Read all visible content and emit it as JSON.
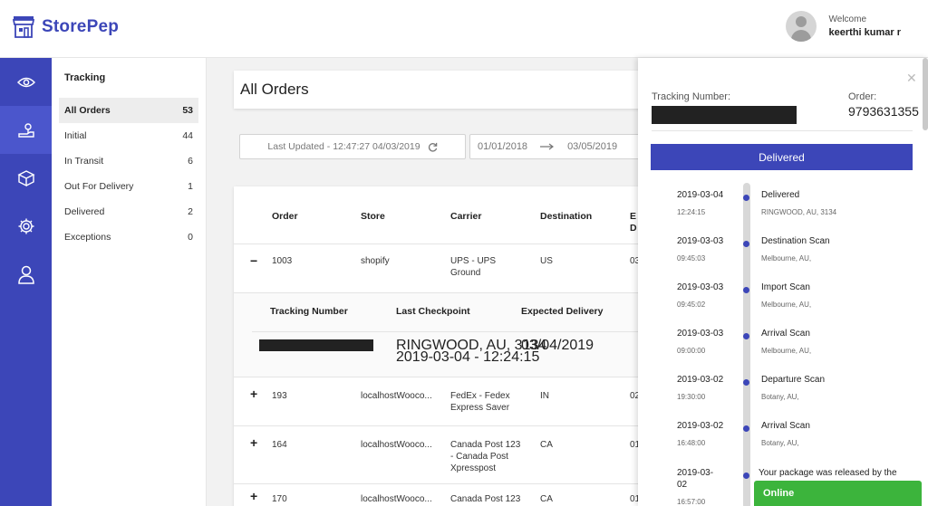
{
  "app": {
    "name": "StorePep"
  },
  "user": {
    "welcome": "Welcome",
    "name": "keerthi kumar r"
  },
  "rail": [
    {
      "icon": "eye-icon"
    },
    {
      "icon": "tracking-icon"
    },
    {
      "icon": "box-icon"
    },
    {
      "icon": "settings-icon"
    },
    {
      "icon": "user-icon"
    }
  ],
  "submenu": {
    "title": "Tracking",
    "items": [
      {
        "label": "All Orders",
        "count": "53"
      },
      {
        "label": "Initial",
        "count": "44"
      },
      {
        "label": "In Transit",
        "count": "6"
      },
      {
        "label": "Out For Delivery",
        "count": "1"
      },
      {
        "label": "Delivered",
        "count": "2"
      },
      {
        "label": "Exceptions",
        "count": "0"
      }
    ]
  },
  "main": {
    "title": "All Orders",
    "last_updated": "Last Updated - 12:47:27 04/03/2019",
    "date_from": "01/01/2018",
    "date_to": "03/05/2019"
  },
  "table": {
    "headers": {
      "order": "Order",
      "store": "Store",
      "carrier": "Carrier",
      "destination": "Destination",
      "expected": "E",
      "expected2": "D"
    },
    "rows": [
      {
        "toggle": "−",
        "order": "1003",
        "store": "shopify",
        "carrier": [
          "UPS - UPS",
          "Ground"
        ],
        "destination": "US",
        "extra": "03"
      },
      {
        "toggle": "+",
        "order": "193",
        "store": "localhostWooco...",
        "carrier": [
          "FedEx - Fedex",
          "Express Saver"
        ],
        "destination": "IN",
        "extra": "02"
      },
      {
        "toggle": "+",
        "order": "164",
        "store": "localhostWooco...",
        "carrier": [
          "Canada Post 123",
          "- Canada Post",
          "Xpresspost"
        ],
        "destination": "CA",
        "extra": "01"
      },
      {
        "toggle": "+",
        "order": "170",
        "store": "localhostWooco...",
        "carrier": [
          "Canada Post 123"
        ],
        "destination": "CA",
        "extra": "01"
      }
    ],
    "sub": {
      "headers": {
        "tracking": "Tracking Number",
        "checkpoint": "Last Checkpoint",
        "expected": "Expected Delivery"
      },
      "checkpoint": [
        "RINGWOOD, AU, 3134",
        "2019-03-04 - 12:24:15"
      ],
      "expected": "03/04/2019"
    }
  },
  "panel": {
    "tracking_label": "Tracking Number:",
    "order_label": "Order:",
    "order_number": "9793631355",
    "status": "Delivered",
    "events": [
      {
        "date": "2019-03-04",
        "time": "12:24:15",
        "status": "Delivered",
        "location": "RINGWOOD, AU, 3134"
      },
      {
        "date": "2019-03-03",
        "time": "09:45:03",
        "status": "Destination Scan",
        "location": "Melbourne, AU,"
      },
      {
        "date": "2019-03-03",
        "time": "09:45:02",
        "status": "Import Scan",
        "location": "Melbourne, AU,"
      },
      {
        "date": "2019-03-03",
        "time": "09:00:00",
        "status": "Arrival Scan",
        "location": "Melbourne, AU,"
      },
      {
        "date": "2019-03-02",
        "time": "19:30:00",
        "status": "Departure Scan",
        "location": "Botany, AU,"
      },
      {
        "date": "2019-03-02",
        "time": "16:48:00",
        "status": "Arrival Scan",
        "location": "Botany, AU,"
      },
      {
        "date": "2019-03-02",
        "time": "16:57:00",
        "status": "Your package was released by the",
        "location": ""
      }
    ]
  },
  "chat": {
    "label": "Online"
  }
}
